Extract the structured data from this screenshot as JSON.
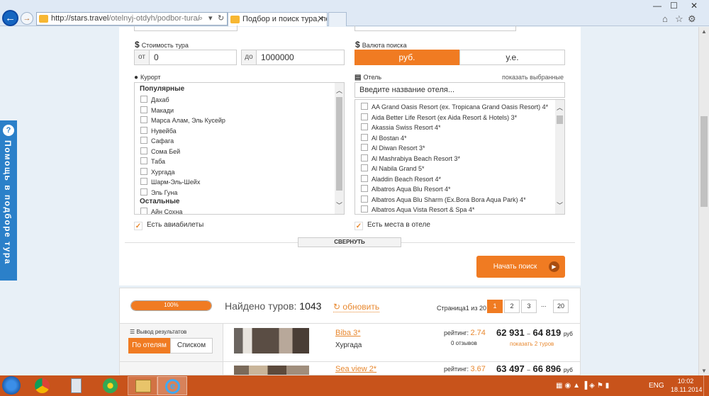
{
  "browser": {
    "url_host": "http://stars.travel",
    "url_path": "/otelnyj-otdyh/podbor-tura/",
    "tab_title": "Подбор и поиск тура, подб...",
    "icons": {
      "back": "back-arrow-icon",
      "forward": "forward-arrow-icon",
      "home": "home-icon",
      "favorites": "star-icon",
      "tools": "gear-icon"
    }
  },
  "help_widget": {
    "label": "Помощь в подборе тура"
  },
  "form": {
    "price": {
      "label": "Стоимость тура",
      "from_prefix": "от",
      "from_value": "0",
      "to_prefix": "до",
      "to_value": "1000000"
    },
    "currency": {
      "label": "Валюта поиска",
      "options": [
        "руб.",
        "у.е."
      ],
      "selected": "руб."
    },
    "resort": {
      "label": "Курорт",
      "popular_header": "Популярные",
      "popular": [
        "Дахаб",
        "Макади",
        "Марса Алам, Эль Кусейр",
        "Нувейба",
        "Сафага",
        "Сома Бей",
        "Таба",
        "Хургада",
        "Шарм-Эль-Шейх",
        "Эль Гуна"
      ],
      "other_header": "Остальные",
      "other": [
        "Айн Сохна"
      ]
    },
    "hotel": {
      "label": "Отель",
      "show_selected": "показать выбранные",
      "search_placeholder": "Введите название отеля...",
      "items": [
        "AA Grand Oasis Resort (ex. Tropicana Grand Oasis Resort) 4*",
        "Aida Better Life Resort (ex Aida Resort & Hotels) 3*",
        "Akassia Swiss Resort 4*",
        "Al Bostan 4*",
        "Al Diwan Resort 3*",
        "Al Mashrabiya Beach Resort 3*",
        "Al Nabila Grand 5*",
        "Aladdin Beach Resort 4*",
        "Albatros Aqua Blu Resort 4*",
        "Albatros Aqua Blu Sharm (Ex.Bora Bora Aqua Park) 4*",
        "Albatros Aqua Vista Resort & Spa 4*"
      ]
    },
    "flights_label": "Есть авиабилеты",
    "hotel_places_label": "Есть места в отеле",
    "collapse_label": "СВЕРНУТЬ",
    "search_button": "Начать поиск"
  },
  "results": {
    "progress_percent": 100,
    "progress_label": "100%",
    "found_label": "Найдено туров:",
    "found_count": "1043",
    "refresh_label": "обновить",
    "page_label": "Страница1 из 20",
    "pages": [
      "1",
      "2",
      "3"
    ],
    "ellipsis": "...",
    "last_page": "20",
    "display_label": "Вывод результатов",
    "view_by_hotels": "По отелям",
    "view_list": "Списком",
    "items": [
      {
        "name": "Biba 3*",
        "city": "Хургада",
        "rating_label": "рейтинг:",
        "rating": "2.74",
        "reviews": "0 отзывов",
        "price_from": "62 931",
        "price_to": "64 819",
        "currency": "руб",
        "show_tours": "показать 2 туров"
      },
      {
        "name": "Sea view 2*",
        "rating_label": "рейтинг:",
        "rating": "3.67",
        "price_from": "63 497",
        "price_to": "66 896",
        "currency": "руб"
      }
    ]
  },
  "taskbar": {
    "lang": "ENG",
    "time": "10:02",
    "date": "18.11.2014"
  },
  "colors": {
    "accent": "#f07b22",
    "help": "#2b80c9",
    "taskbar": "#c8531b"
  }
}
